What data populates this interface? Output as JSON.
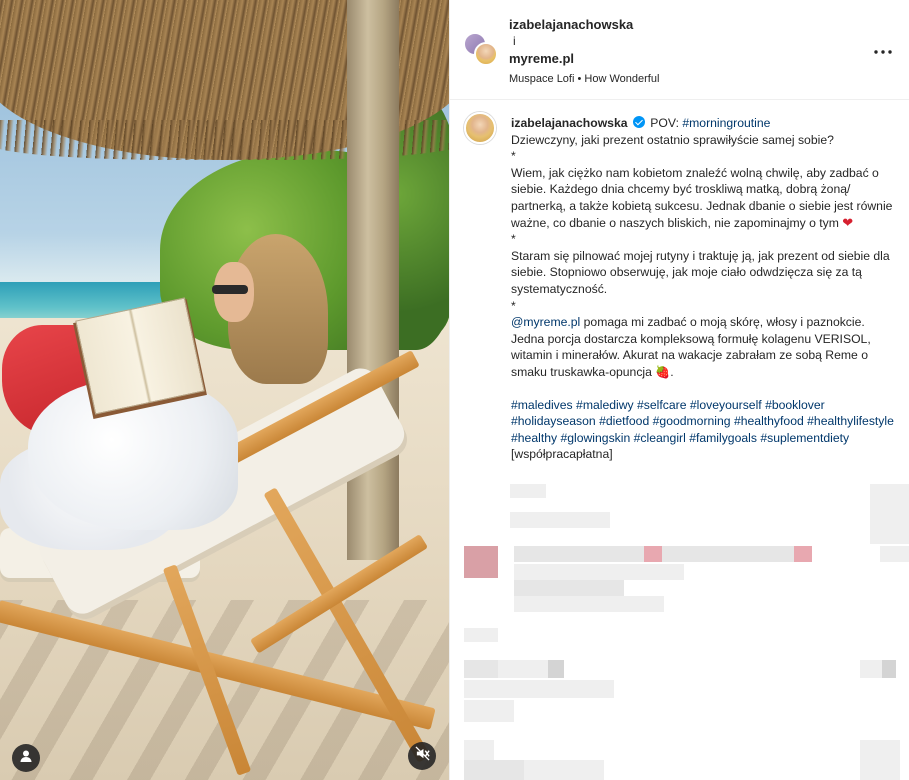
{
  "header": {
    "username1": "izabelajanachowska",
    "separator": "i",
    "username2": "myreme.pl",
    "audio": "Muspace Lofi • How Wonderful",
    "more_icon": "more-horizontal-icon"
  },
  "caption": {
    "username": "izabelajanachowska",
    "verified_icon": "verified-badge-icon",
    "intro_pov": "POV:",
    "intro_tag": "#morningroutine",
    "line_question": "Dziewczyny, jaki prezent ostatnio sprawiłyście samej sobie?",
    "star": "*",
    "para1": "Wiem, jak ciężko nam kobietom znaleźć wolną chwilę, aby zadbać o siebie. Każdego dnia chcemy być troskliwą matką, dobrą żoną/ partnerką, a także kobietą sukcesu. Jednak dbanie o siebie jest równie ważne, co dbanie o naszych bliskich, nie zapominajmy o tym",
    "heart_emoji": "❤",
    "para2": "Staram się pilnować mojej rutyny i traktuję ją, jak prezent od siebie dla siebie. Stopniowo obserwuję, jak moje ciało odwdzięcza się za tą systematyczność.",
    "mention": "@myreme.pl",
    "para3": "pomaga mi zadbać o moją skórę, włosy i paznokcie. Jedna porcja dostarcza kompleksową formułę kolagenu VERISOL, witamin i minerałów. Akurat na wakacje zabrałam ze sobą Reme o smaku truskawka-opuncja",
    "strawberry_emoji": "🍓",
    "period": ".",
    "hashtags": [
      "#maledives",
      "#malediwy",
      "#selfcare",
      "#loveyourself",
      "#booklover",
      "#holidayseason",
      "#dietfood",
      "#goodmorning",
      "#healthyfood",
      "#healthylifestyle",
      "#healthy",
      "#glowingskin",
      "#cleangirl",
      "#familygoals",
      "#suplementdiety"
    ],
    "paid_label": "[współpracapłatna]"
  },
  "media": {
    "user_icon": "user-tag-icon",
    "mute_icon": "audio-muted-icon"
  }
}
